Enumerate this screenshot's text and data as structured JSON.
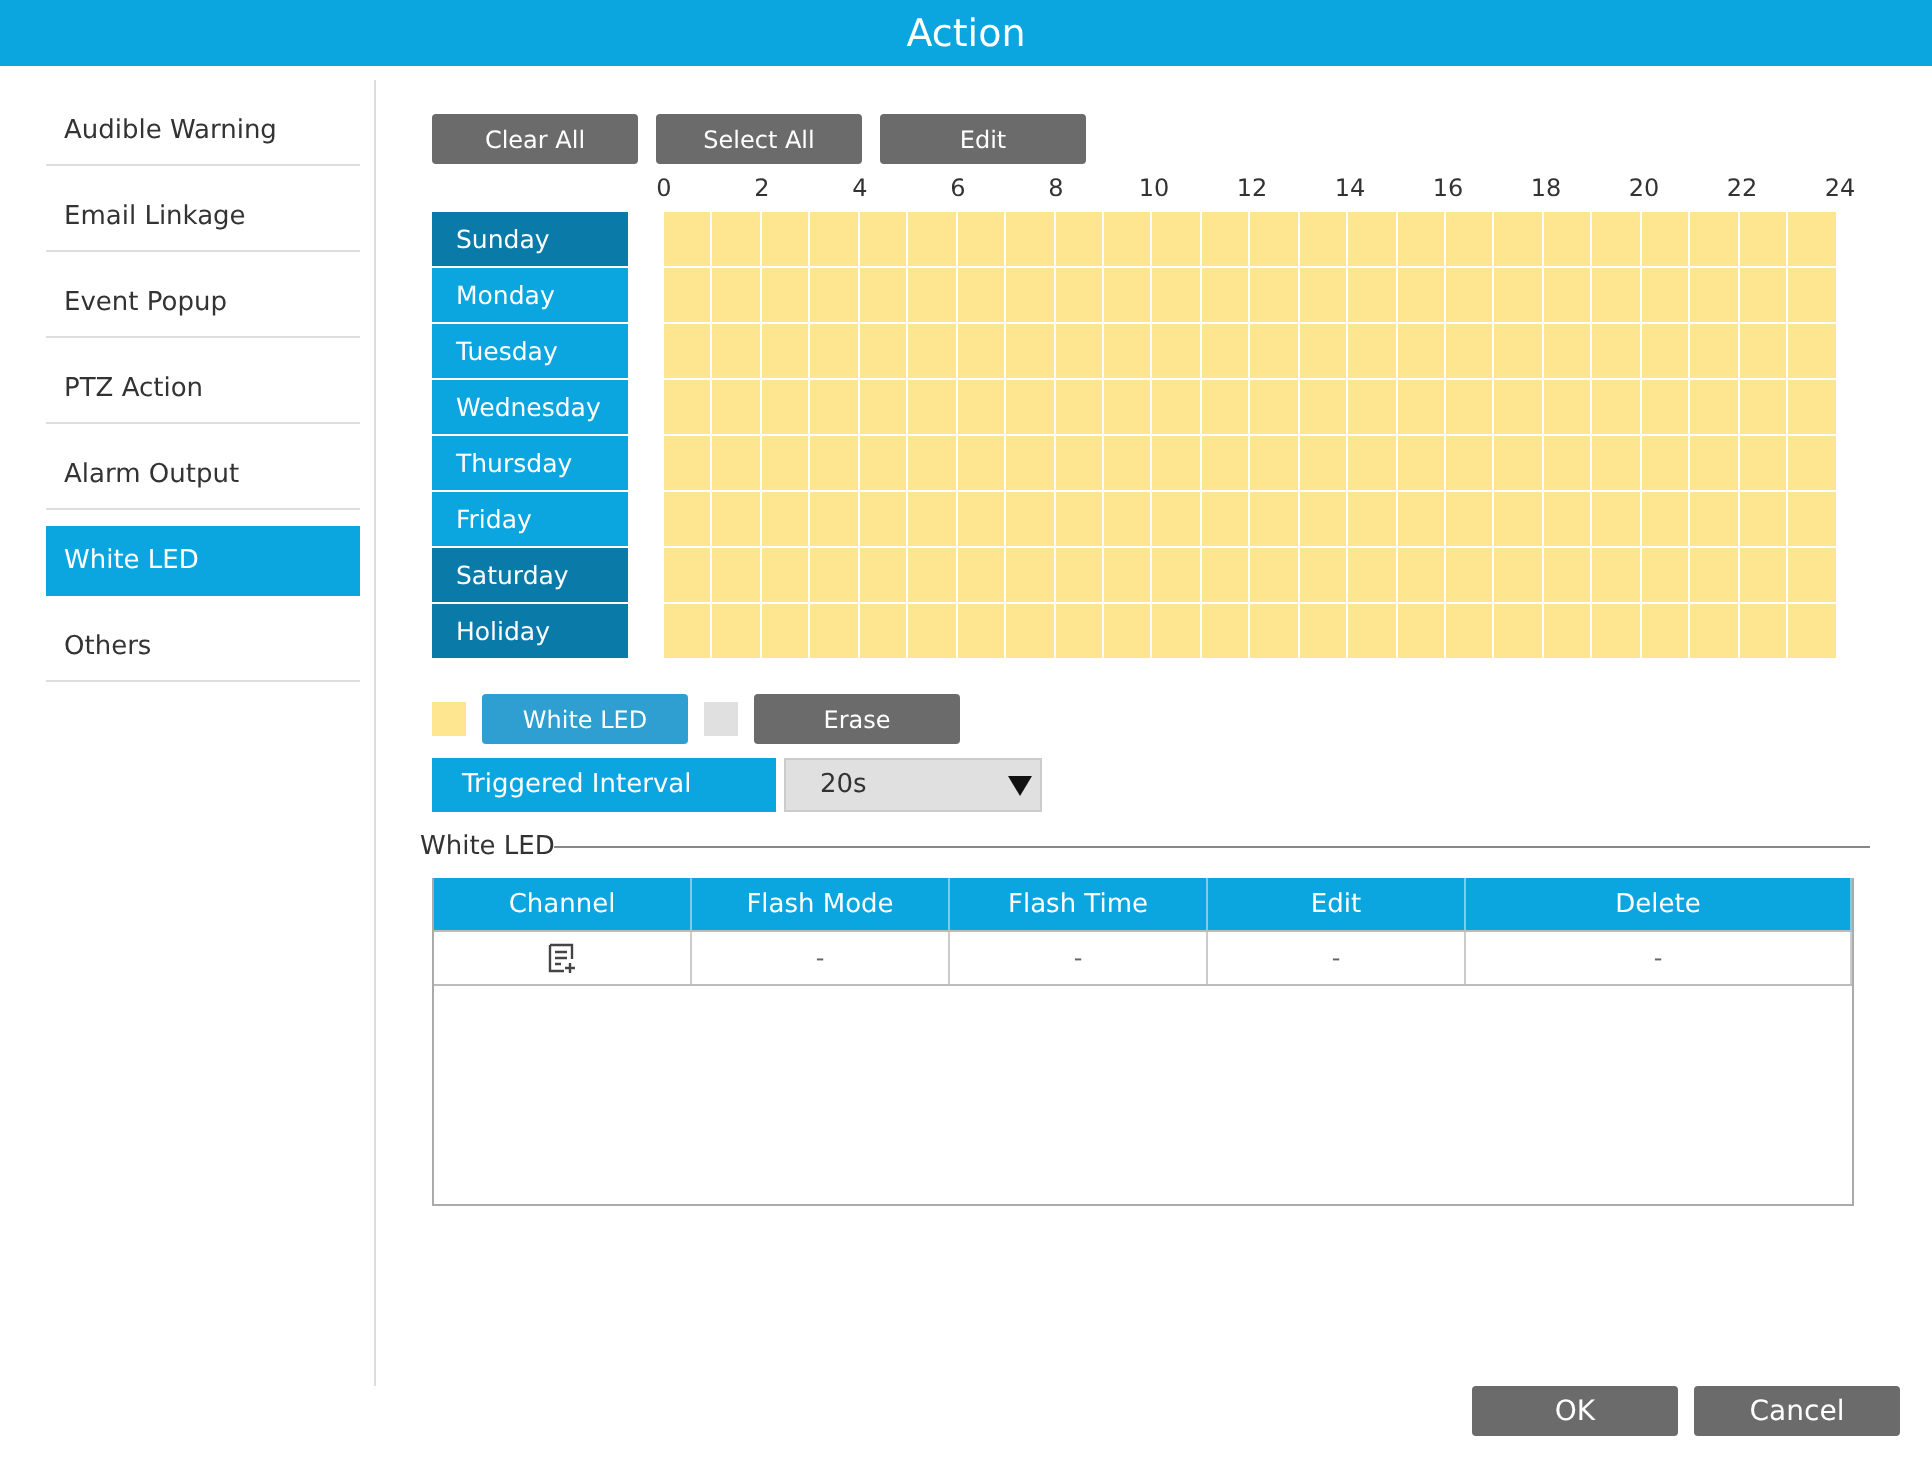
{
  "window": {
    "title": "Action"
  },
  "sidebar": {
    "items": [
      {
        "label": "Audible Warning",
        "selected": false
      },
      {
        "label": "Email Linkage",
        "selected": false
      },
      {
        "label": "Event Popup",
        "selected": false
      },
      {
        "label": "PTZ Action",
        "selected": false
      },
      {
        "label": "Alarm Output",
        "selected": false
      },
      {
        "label": "White LED",
        "selected": true
      },
      {
        "label": "Others",
        "selected": false
      }
    ]
  },
  "toolbar": [
    "Clear All",
    "Select All",
    "Edit"
  ],
  "schedule": {
    "hours": [
      "0",
      "2",
      "4",
      "6",
      "8",
      "10",
      "12",
      "14",
      "16",
      "18",
      "20",
      "22",
      "24"
    ],
    "days": [
      {
        "label": "Sunday",
        "color": "#0a7aa8",
        "filled": true
      },
      {
        "label": "Monday",
        "color": "#0ba5e0",
        "filled": true
      },
      {
        "label": "Tuesday",
        "color": "#0ba5e0",
        "filled": true
      },
      {
        "label": "Wednesday",
        "color": "#0ba5e0",
        "filled": true
      },
      {
        "label": "Thursday",
        "color": "#0ba5e0",
        "filled": true
      },
      {
        "label": "Friday",
        "color": "#0ba5e0",
        "filled": true
      },
      {
        "label": "Saturday",
        "color": "#0a7aa8",
        "filled": true
      },
      {
        "label": "Holiday",
        "color": "#0a7aa8",
        "filled": true
      }
    ]
  },
  "brushes": [
    {
      "label": "White LED",
      "color": "#fde68f",
      "selected": true
    },
    {
      "label": "Erase",
      "color": "#e0e0e0",
      "selected": false
    }
  ],
  "triggered_interval": {
    "label": "Triggered Interval",
    "value": "20s"
  },
  "section": {
    "title": "White LED",
    "columns": [
      "Channel",
      "Flash Mode",
      "Flash Time",
      "Edit",
      "Delete"
    ],
    "rows": [
      {
        "channel": {
          "kind": "add"
        },
        "flash_mode": "-",
        "flash_time": "-",
        "edit": "-",
        "delete": "-"
      }
    ]
  },
  "footer": [
    "OK",
    "Cancel"
  ]
}
